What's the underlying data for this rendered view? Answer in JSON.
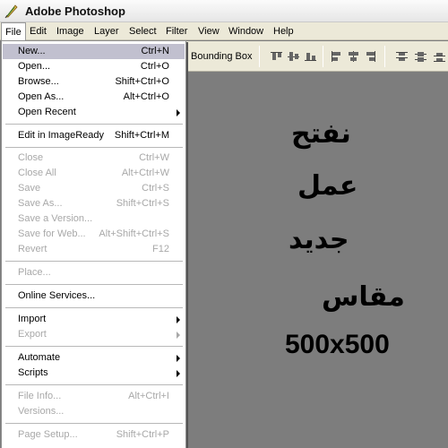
{
  "window": {
    "title": "Adobe Photoshop"
  },
  "menubar": [
    "File",
    "Edit",
    "Image",
    "Layer",
    "Select",
    "Filter",
    "View",
    "Window",
    "Help"
  ],
  "options": {
    "bounding_box_label": "Bounding Box"
  },
  "file_menu": [
    {
      "label": "New...",
      "shortcut": "Ctrl+N",
      "highlighted": true
    },
    {
      "label": "Open...",
      "shortcut": "Ctrl+O"
    },
    {
      "label": "Browse...",
      "shortcut": "Shift+Ctrl+O"
    },
    {
      "label": "Open As...",
      "shortcut": "Alt+Ctrl+O"
    },
    {
      "label": "Open Recent",
      "submenu": true
    },
    {
      "label": "Edit in ImageReady",
      "shortcut": "Shift+Ctrl+M"
    },
    {
      "label": "Close",
      "shortcut": "Ctrl+W",
      "disabled": true
    },
    {
      "label": "Close All",
      "shortcut": "Alt+Ctrl+W",
      "disabled": true
    },
    {
      "label": "Save",
      "shortcut": "Ctrl+S",
      "disabled": true
    },
    {
      "label": "Save As...",
      "shortcut": "Shift+Ctrl+S",
      "disabled": true
    },
    {
      "label": "Save a Version...",
      "disabled": true
    },
    {
      "label": "Save for Web...",
      "shortcut": "Alt+Shift+Ctrl+S",
      "disabled": true
    },
    {
      "label": "Revert",
      "shortcut": "F12",
      "disabled": true
    },
    {
      "label": "Place...",
      "disabled": true
    },
    {
      "label": "Online Services..."
    },
    {
      "label": "Import",
      "submenu": true
    },
    {
      "label": "Export",
      "submenu": true,
      "disabled": true
    },
    {
      "label": "Automate",
      "submenu": true
    },
    {
      "label": "Scripts",
      "submenu": true
    },
    {
      "label": "File Info...",
      "shortcut": "Alt+Ctrl+I",
      "disabled": true
    },
    {
      "label": "Versions...",
      "disabled": true
    },
    {
      "label": "Page Setup...",
      "shortcut": "Shift+Ctrl+P",
      "disabled": true
    }
  ],
  "canvas_text": {
    "line1": "نفتح",
    "line2": "عمل",
    "line3": "جديد",
    "line4": "مقاس",
    "size": "500x500"
  }
}
